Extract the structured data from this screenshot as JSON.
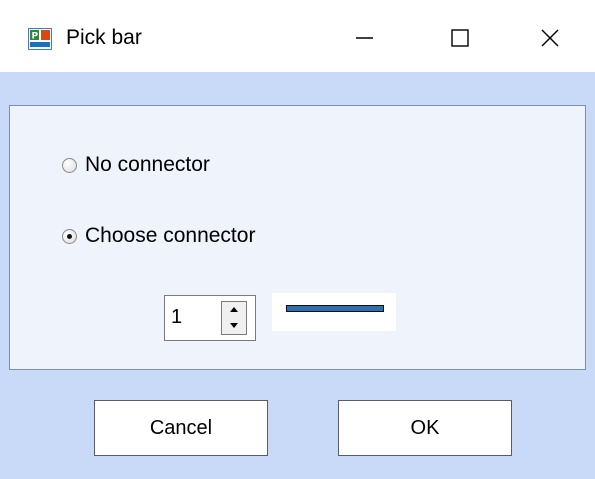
{
  "window": {
    "title": "Pick bar",
    "icon": "app-chart-icon",
    "controls": [
      "minimize-icon",
      "maximize-icon",
      "close-icon"
    ]
  },
  "options": [
    {
      "label": "No connector",
      "selected": false
    },
    {
      "label": "Choose connector",
      "selected": true
    }
  ],
  "connector": {
    "spin_value": "1",
    "line_color": "#2f6fb1"
  },
  "buttons": {
    "cancel_label": "Cancel",
    "ok_label": "OK"
  },
  "colors": {
    "client_background": "#c9daf8",
    "panel_background": "#eff3fc"
  }
}
